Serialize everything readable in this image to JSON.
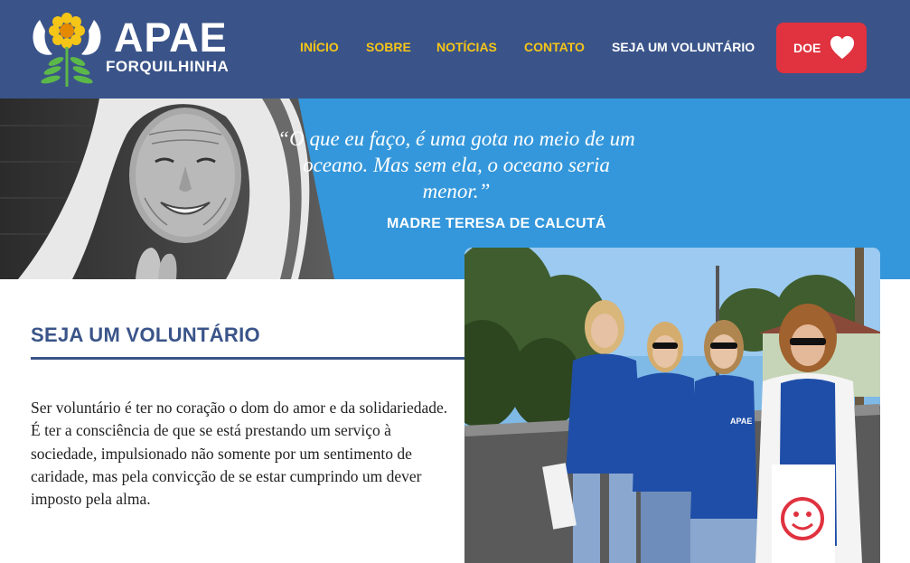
{
  "brand": {
    "title": "APAE",
    "subtitle": "FORQUILHINHA"
  },
  "nav": {
    "items": [
      {
        "label": "INÍCIO",
        "active": false
      },
      {
        "label": "SOBRE",
        "active": false
      },
      {
        "label": "NOTÍCIAS",
        "active": false
      },
      {
        "label": "CONTATO",
        "active": false
      },
      {
        "label": "SEJA UM VOLUNTÁRIO",
        "active": true
      }
    ],
    "donate_label": "DOE",
    "donate_icon": "heart-icon"
  },
  "hero": {
    "quote": "“O que eu faço, é uma gota no meio de um oceano. Mas sem ela, o oceano seria menor.”",
    "author": "MADRE TERESA DE CALCUTÁ"
  },
  "content": {
    "title": "SEJA UM VOLUNTÁRIO",
    "body": "Ser voluntário é ter no coração o dom do amor e da solidariedade. É ter a consciência de que se está prestando um serviço à sociedade, impulsionado não somente por um sentimento de caridade, mas pela convicção de se estar cumprindo um dever imposto pela alma.",
    "photo_badge_text": "APAE"
  },
  "colors": {
    "header_bg": "#3a5489",
    "nav_text": "#f5c518",
    "nav_active": "#ffffff",
    "donate_bg": "#e0323f",
    "hero_bg": "#3497db",
    "title_color": "#3a5489"
  }
}
